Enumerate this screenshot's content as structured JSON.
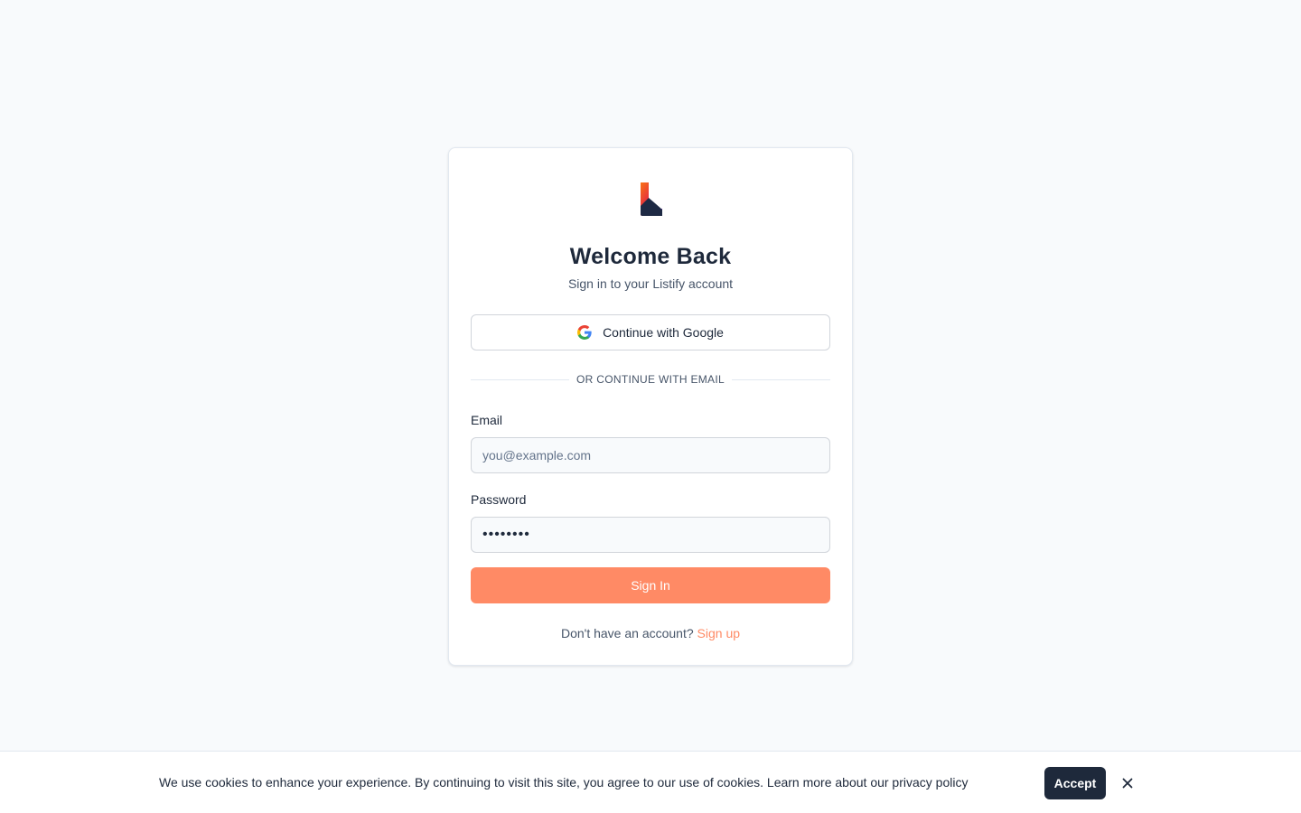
{
  "login": {
    "title": "Welcome Back",
    "subtitle": "Sign in to your Listify account",
    "google_button_label": "Continue with Google",
    "divider_text": "OR CONTINUE WITH EMAIL",
    "email_label": "Email",
    "email_placeholder": "you@example.com",
    "email_value": "",
    "password_label": "Password",
    "password_value": "••••••••",
    "submit_label": "Sign In",
    "signup_prompt": "Don't have an account?",
    "signup_link": "Sign up"
  },
  "cookie_banner": {
    "text": "We use cookies to enhance your experience. By continuing to visit this site, you agree to our use of cookies.",
    "link_text": "Learn more about our privacy policy",
    "accept_label": "Accept",
    "close_icon": "close-icon"
  },
  "icons": {
    "logo": "listify-logo",
    "google": "google-icon",
    "close": "close-icon"
  },
  "colors": {
    "background": "#f8fafc",
    "accent": "#ff8a65",
    "text_primary": "#1e293b",
    "text_secondary": "#475569",
    "accept_button": "#1e293b",
    "card": "#ffffff"
  }
}
